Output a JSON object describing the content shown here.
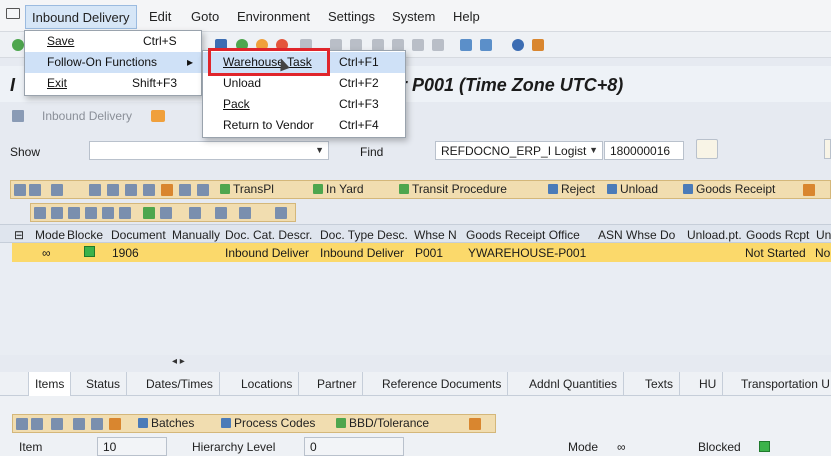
{
  "menubar": {
    "items": [
      "Inbound Delivery",
      "Edit",
      "Goto",
      "Environment",
      "Settings",
      "System",
      "Help"
    ]
  },
  "title": "umber P001 (Time Zone UTC+8)",
  "title_lead": "I",
  "inbound_button": "Inbound Delivery",
  "filter": {
    "show_label": "Show",
    "show_value": "",
    "find_label": "Find",
    "find_field": "REFDOCNO_ERP_I Logist",
    "find_value": "180000016"
  },
  "grid_toolbar": {
    "transpl": "TransPl",
    "in_yard": "In Yard",
    "transit": "Transit Procedure",
    "reject": "Reject",
    "unload": "Unload",
    "goods_receipt": "Goods Receipt"
  },
  "table": {
    "columns": [
      "Mode",
      "Blocke",
      "Document",
      "Manually",
      "Doc. Cat. Descr.",
      "Doc. Type Desc.",
      "Whse N",
      "Goods Receipt Office",
      "ASN",
      "Whse Do",
      "Unload.pt.",
      "Goods Rcpt",
      "Un"
    ],
    "rows": [
      {
        "document": "1906",
        "doc_cat": "Inbound Deliver",
        "doc_type": "Inbound Deliver",
        "whse": "P001",
        "gr_office": "YWAREHOUSE-P001",
        "goods_rcpt": "Not Started",
        "un": "No"
      }
    ]
  },
  "scroll_arrows": "◂ ▸",
  "tabs": [
    "Items",
    "Status",
    "Dates/Times",
    "Locations",
    "Partner",
    "Reference Documents",
    "Addnl Quantities",
    "Texts",
    "HU",
    "Transportation U"
  ],
  "detail_toolbar": {
    "batches": "Batches",
    "process_codes": "Process Codes",
    "bbd": "BBD/Tolerance"
  },
  "detail": {
    "item_label": "Item",
    "item_value": "10",
    "hier_label": "Hierarchy Level",
    "hier_value": "0",
    "mode_label": "Mode",
    "blocked_label": "Blocked"
  },
  "menu_main": [
    {
      "label": "Save",
      "shortcut": "Ctrl+S"
    },
    {
      "label": "Follow-On Functions",
      "shortcut": "▸"
    },
    {
      "label": "Exit",
      "shortcut": "Shift+F3"
    }
  ],
  "menu_sub": [
    {
      "label": "Warehouse Task",
      "shortcut": "Ctrl+F1"
    },
    {
      "label": "Unload",
      "shortcut": "Ctrl+F2"
    },
    {
      "label": "Pack",
      "shortcut": "Ctrl+F3"
    },
    {
      "label": "Return to Vendor",
      "shortcut": "Ctrl+F4"
    }
  ],
  "colors": {
    "selected_row": "#fbd96b",
    "grid_toolbar": "#f1ddb0",
    "highlight_box": "#e0252b",
    "menu_hover": "#cfe1f7"
  }
}
